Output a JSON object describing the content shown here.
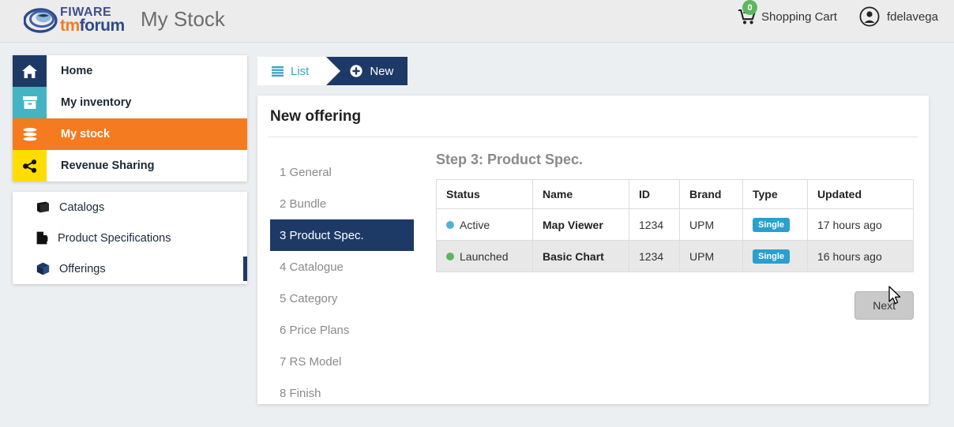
{
  "header": {
    "logo": {
      "mark_icon": "fiware-swirl-icon",
      "fiware_text": "FIWARE",
      "tm_text": "tm",
      "forum_text": "forum"
    },
    "app_title": "My Stock",
    "cart": {
      "icon": "shopping-cart-icon",
      "badge_count": "0",
      "label": "Shopping Cart"
    },
    "user": {
      "icon": "user-circle-icon",
      "name": "fdelavega"
    }
  },
  "sidebar": {
    "main_items": [
      {
        "label": "Home",
        "icon": "home-icon",
        "icon_bg": "#1d3a67",
        "row_bg": "#ffffff",
        "active": false
      },
      {
        "label": "My inventory",
        "icon": "inventory-box-icon",
        "icon_bg": "#44b3c2",
        "row_bg": "#ffffff",
        "active": false
      },
      {
        "label": "My stock",
        "icon": "database-stack-icon",
        "icon_bg": "#f47b20",
        "row_bg": "#f47b20",
        "active": true
      },
      {
        "label": "Revenue Sharing",
        "icon": "share-nodes-icon",
        "icon_bg": "#ffdd00",
        "row_bg": "#ffffff",
        "active": false
      }
    ],
    "sub_items": [
      {
        "label": "Catalogs",
        "icon": "book-icon",
        "active": false
      },
      {
        "label": "Product Specifications",
        "icon": "file-text-icon",
        "active": false
      },
      {
        "label": "Offerings",
        "icon": "cube-icon",
        "active": true
      }
    ]
  },
  "tabs": [
    {
      "label": "List",
      "icon": "list-icon",
      "active": false
    },
    {
      "label": "New",
      "icon": "plus-circle-icon",
      "active": true
    }
  ],
  "panel": {
    "title": "New offering",
    "steps": [
      {
        "label": "1 General",
        "current": false
      },
      {
        "label": "2 Bundle",
        "current": false
      },
      {
        "label": "3 Product Spec.",
        "current": true
      },
      {
        "label": "4 Catalogue",
        "current": false
      },
      {
        "label": "5 Category",
        "current": false
      },
      {
        "label": "6 Price Plans",
        "current": false
      },
      {
        "label": "7 RS Model",
        "current": false
      },
      {
        "label": "8 Finish",
        "current": false
      }
    ],
    "step_heading": "Step 3: Product Spec.",
    "table": {
      "columns": [
        "Status",
        "Name",
        "ID",
        "Brand",
        "Type",
        "Updated"
      ],
      "rows": [
        {
          "status": "Active",
          "status_color": "#4eb3d3",
          "name": "Map Viewer",
          "id": "1234",
          "brand": "UPM",
          "type": "Single",
          "updated": "17 hours ago"
        },
        {
          "status": "Launched",
          "status_color": "#5cb85c",
          "name": "Basic Chart",
          "id": "1234",
          "brand": "UPM",
          "type": "Single",
          "updated": "16 hours ago"
        }
      ]
    },
    "next_button": "Next"
  },
  "colors": {
    "navy": "#1d3a67",
    "teal": "#44b3c2",
    "orange": "#f47b20",
    "yellow": "#ffdd00",
    "badge_blue": "#2a9fd0",
    "page_bg": "#eceff1"
  }
}
